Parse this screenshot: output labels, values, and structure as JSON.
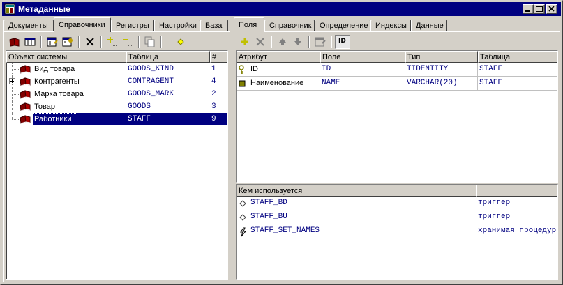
{
  "window": {
    "title": "Метаданные",
    "title_bg": "#000080"
  },
  "left": {
    "tabs": [
      {
        "label": "Документы"
      },
      {
        "label": "Справочники",
        "active": true
      },
      {
        "label": "Регистры"
      },
      {
        "label": "Настройки"
      },
      {
        "label": "База"
      }
    ],
    "toolbar": [
      "book-open-icon",
      "table-icon",
      "properties-icon",
      "properties-alt-icon",
      "delete-icon",
      "add-field-icon",
      "remove-field-icon",
      "copy-icon",
      "diamond-icon"
    ],
    "columns": [
      "Объект системы",
      "Таблица",
      "#"
    ],
    "rows": [
      {
        "name": "Вид товара",
        "table": "GOODS_KIND",
        "num": "1",
        "expandable": false,
        "selected": false
      },
      {
        "name": "Контрагенты",
        "table": "CONTRAGENT",
        "num": "4",
        "expandable": true,
        "selected": false
      },
      {
        "name": "Марка товара",
        "table": "GOODS_MARK",
        "num": "2",
        "expandable": false,
        "selected": false
      },
      {
        "name": "Товар",
        "table": "GOODS",
        "num": "3",
        "expandable": false,
        "selected": false
      },
      {
        "name": "Работники",
        "table": "STAFF",
        "num": "9",
        "expandable": false,
        "selected": true
      }
    ]
  },
  "right": {
    "tabs": [
      {
        "label": "Поля",
        "active": true
      },
      {
        "label": "Справочник"
      },
      {
        "label": "Определение"
      },
      {
        "label": "Индексы"
      },
      {
        "label": "Данные"
      }
    ],
    "toolbar": [
      "add-icon",
      "delete-icon",
      "move-up-icon",
      "move-down-icon",
      "properties-icon",
      "id-button"
    ],
    "id_button_label": "ID",
    "fields": {
      "columns": [
        "Атрибут",
        "Поле",
        "Тип",
        "Таблица"
      ],
      "rows": [
        {
          "attr": "ID",
          "field": "ID",
          "type": "TIDENTITY",
          "table": "STAFF",
          "icon": "key-icon"
        },
        {
          "attr": "Наименование",
          "field": "NAME",
          "type": "VARCHAR(20)",
          "table": "STAFF",
          "icon": "field-icon"
        }
      ]
    },
    "usage": {
      "columns": [
        "Кем используется",
        ""
      ],
      "rows": [
        {
          "name": "STAFF_BD",
          "kind": "триггер",
          "icon": "trigger-icon"
        },
        {
          "name": "STAFF_BU",
          "kind": "триггер",
          "icon": "trigger-icon"
        },
        {
          "name": "STAFF_SET_NAMES",
          "kind": "хранимая процедура",
          "icon": "procedure-icon"
        }
      ]
    }
  }
}
